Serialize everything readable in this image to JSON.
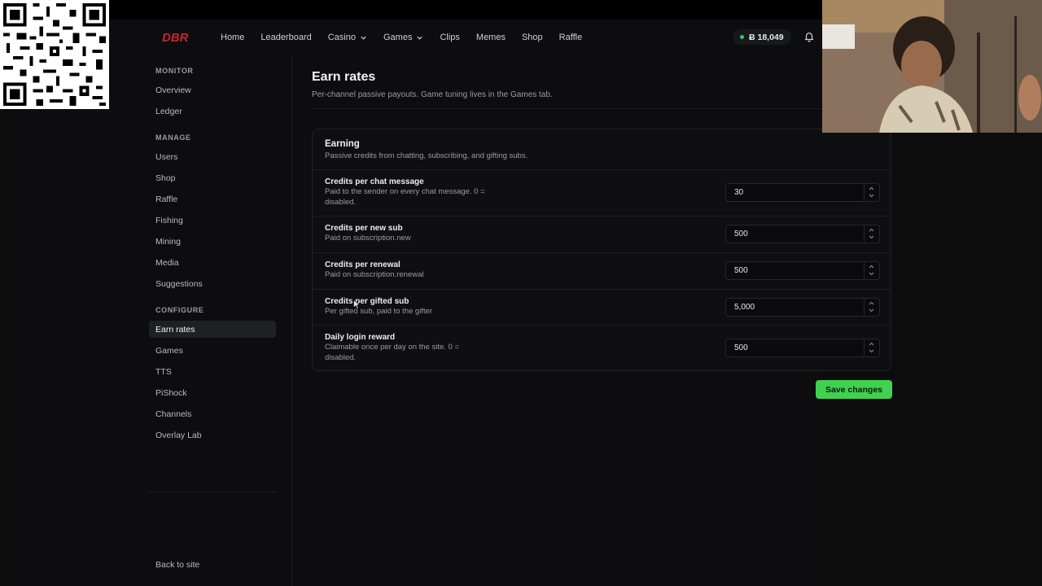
{
  "header": {
    "logo_text": "DBR",
    "nav": [
      {
        "label": "Home",
        "dropdown": false
      },
      {
        "label": "Leaderboard",
        "dropdown": false
      },
      {
        "label": "Casino",
        "dropdown": true
      },
      {
        "label": "Games",
        "dropdown": true
      },
      {
        "label": "Clips",
        "dropdown": false
      },
      {
        "label": "Memes",
        "dropdown": false
      },
      {
        "label": "Shop",
        "dropdown": false
      },
      {
        "label": "Raffle",
        "dropdown": false
      }
    ],
    "balance": "Ƀ 18,049",
    "notifications_icon": "bell-icon"
  },
  "sidebar": {
    "sections": [
      {
        "title": "MONITOR",
        "items": [
          "Overview",
          "Ledger"
        ]
      },
      {
        "title": "MANAGE",
        "items": [
          "Users",
          "Shop",
          "Raffle",
          "Fishing",
          "Mining",
          "Media",
          "Suggestions"
        ]
      },
      {
        "title": "CONFIGURE",
        "items": [
          "Earn rates",
          "Games",
          "TTS",
          "PiShock",
          "Channels",
          "Overlay Lab"
        ]
      }
    ],
    "active_item": "Earn rates",
    "back_link": "Back to site"
  },
  "main": {
    "title": "Earn rates",
    "subtitle": "Per-channel passive payouts. Game tuning lives in the Games tab.",
    "card": {
      "title": "Earning",
      "subtitle": "Passive credits from chatting, subscribing, and gifting subs.",
      "rows": [
        {
          "label": "Credits per chat message",
          "desc_line1": "Paid to the sender on every chat message. 0 =",
          "desc_line2": "disabled.",
          "value": "30"
        },
        {
          "label": "Credits per new sub",
          "desc_line1": "Paid on subscription.new",
          "desc_line2": "",
          "value": "500"
        },
        {
          "label": "Credits per renewal",
          "desc_line1": "Paid on subscription.renewal",
          "desc_line2": "",
          "value": "500"
        },
        {
          "label": "Credits per gifted sub",
          "desc_line1": "Per gifted sub, paid to the gifter",
          "desc_line2": "",
          "value": "5,000"
        },
        {
          "label": "Daily login reward",
          "desc_line1": "Claimable once per day on the site. 0 =",
          "desc_line2": "disabled.",
          "value": "500"
        }
      ]
    },
    "save_label": "Save changes"
  },
  "colors": {
    "accent_green": "#3fd24e",
    "brand_red": "#c8242c",
    "background": "#0d0d0f"
  }
}
